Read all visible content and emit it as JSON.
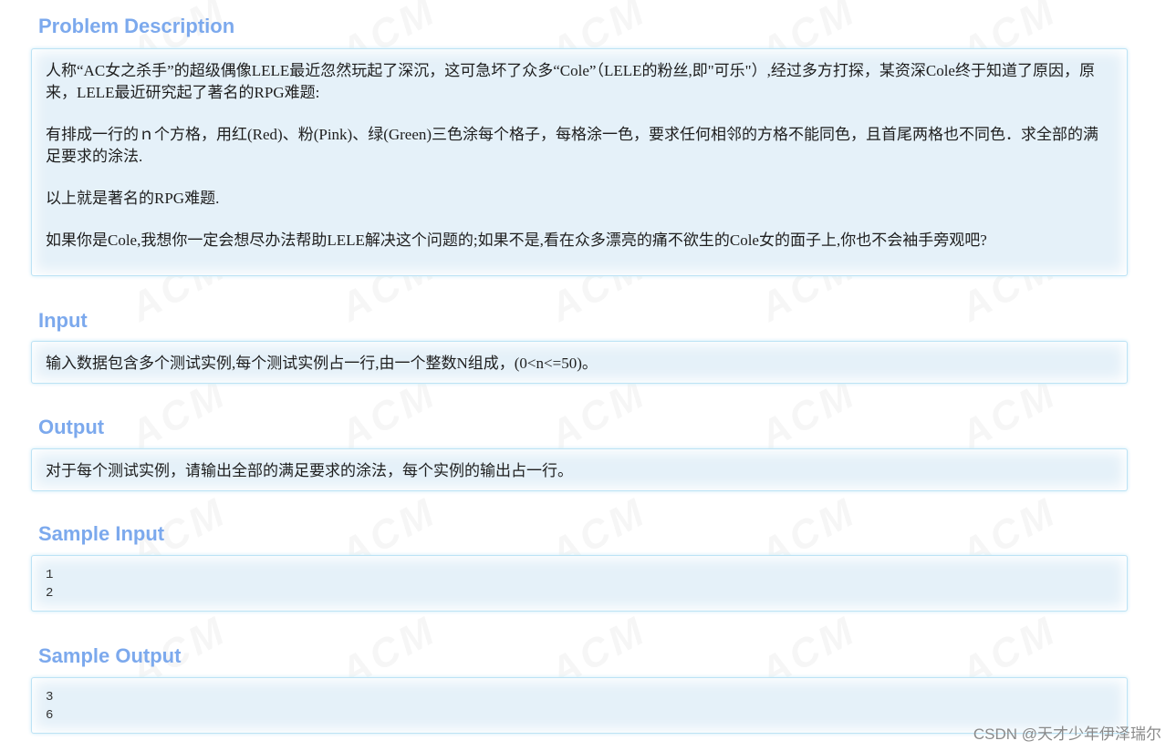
{
  "watermark_text": "ACM",
  "problem_description": {
    "title": "Problem Description",
    "paragraphs": [
      "人称“AC女之杀手”的超级偶像LELE最近忽然玩起了深沉，这可急坏了众多“Cole”（LELE的粉丝,即\"可乐\"）,经过多方打探，某资深Cole终于知道了原因，原来，LELE最近研究起了著名的RPG难题:",
      "有排成一行的ｎ个方格，用红(Red)、粉(Pink)、绿(Green)三色涂每个格子，每格涂一色，要求任何相邻的方格不能同色，且首尾两格也不同色．求全部的满足要求的涂法.",
      "以上就是著名的RPG难题.",
      "如果你是Cole,我想你一定会想尽办法帮助LELE解决这个问题的;如果不是,看在众多漂亮的痛不欲生的Cole女的面子上,你也不会袖手旁观吧?"
    ]
  },
  "input": {
    "title": "Input",
    "text": "输入数据包含多个测试实例,每个测试实例占一行,由一个整数N组成，(0<n<=50)。"
  },
  "output": {
    "title": "Output",
    "text": "对于每个测试实例，请输出全部的满足要求的涂法，每个实例的输出占一行。"
  },
  "sample_input": {
    "title": "Sample Input",
    "lines": [
      "1",
      "2"
    ]
  },
  "sample_output": {
    "title": "Sample Output",
    "lines": [
      "3",
      "6"
    ]
  },
  "credit": "CSDN @天才少年伊泽瑞尔"
}
